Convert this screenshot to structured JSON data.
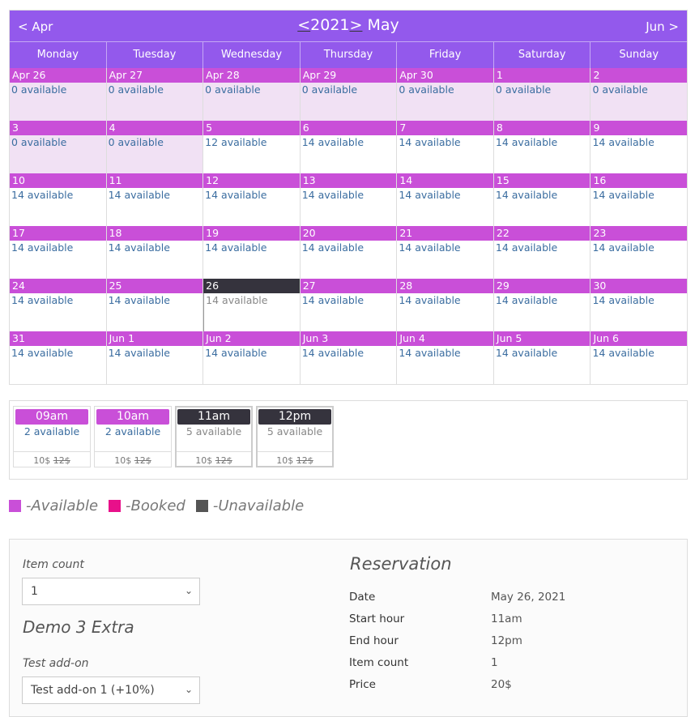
{
  "calendar": {
    "prev_month": "< Apr",
    "next_month": "Jun >",
    "year_prev": "<",
    "year": "2021",
    "year_next": ">",
    "month": "May",
    "weekdays": [
      "Monday",
      "Tuesday",
      "Wednesday",
      "Thursday",
      "Friday",
      "Saturday",
      "Sunday"
    ],
    "weeks": [
      [
        {
          "d": "Apr 26",
          "a": "0 available",
          "s": "past"
        },
        {
          "d": "Apr 27",
          "a": "0 available",
          "s": "past"
        },
        {
          "d": "Apr 28",
          "a": "0 available",
          "s": "past"
        },
        {
          "d": "Apr 29",
          "a": "0 available",
          "s": "past"
        },
        {
          "d": "Apr 30",
          "a": "0 available",
          "s": "past"
        },
        {
          "d": "1",
          "a": "0 available",
          "s": "past"
        },
        {
          "d": "2",
          "a": "0 available",
          "s": "past"
        }
      ],
      [
        {
          "d": "3",
          "a": "0 available",
          "s": "past"
        },
        {
          "d": "4",
          "a": "0 available",
          "s": "past"
        },
        {
          "d": "5",
          "a": "12 available",
          "s": ""
        },
        {
          "d": "6",
          "a": "14 available",
          "s": ""
        },
        {
          "d": "7",
          "a": "14 available",
          "s": ""
        },
        {
          "d": "8",
          "a": "14 available",
          "s": ""
        },
        {
          "d": "9",
          "a": "14 available",
          "s": ""
        }
      ],
      [
        {
          "d": "10",
          "a": "14 available",
          "s": ""
        },
        {
          "d": "11",
          "a": "14 available",
          "s": ""
        },
        {
          "d": "12",
          "a": "14 available",
          "s": ""
        },
        {
          "d": "13",
          "a": "14 available",
          "s": ""
        },
        {
          "d": "14",
          "a": "14 available",
          "s": ""
        },
        {
          "d": "15",
          "a": "14 available",
          "s": ""
        },
        {
          "d": "16",
          "a": "14 available",
          "s": ""
        }
      ],
      [
        {
          "d": "17",
          "a": "14 available",
          "s": ""
        },
        {
          "d": "18",
          "a": "14 available",
          "s": ""
        },
        {
          "d": "19",
          "a": "14 available",
          "s": ""
        },
        {
          "d": "20",
          "a": "14 available",
          "s": ""
        },
        {
          "d": "21",
          "a": "14 available",
          "s": ""
        },
        {
          "d": "22",
          "a": "14 available",
          "s": ""
        },
        {
          "d": "23",
          "a": "14 available",
          "s": ""
        }
      ],
      [
        {
          "d": "24",
          "a": "14 available",
          "s": ""
        },
        {
          "d": "25",
          "a": "14 available",
          "s": ""
        },
        {
          "d": "26",
          "a": "14 available",
          "s": "sel"
        },
        {
          "d": "27",
          "a": "14 available",
          "s": ""
        },
        {
          "d": "28",
          "a": "14 available",
          "s": ""
        },
        {
          "d": "29",
          "a": "14 available",
          "s": ""
        },
        {
          "d": "30",
          "a": "14 available",
          "s": ""
        }
      ],
      [
        {
          "d": "31",
          "a": "14 available",
          "s": ""
        },
        {
          "d": "Jun 1",
          "a": "14 available",
          "s": ""
        },
        {
          "d": "Jun 2",
          "a": "14 available",
          "s": ""
        },
        {
          "d": "Jun 3",
          "a": "14 available",
          "s": ""
        },
        {
          "d": "Jun 4",
          "a": "14 available",
          "s": ""
        },
        {
          "d": "Jun 5",
          "a": "14 available",
          "s": ""
        },
        {
          "d": "Jun 6",
          "a": "14 available",
          "s": ""
        }
      ]
    ]
  },
  "slots": [
    {
      "time": "09am",
      "avail": "2 available",
      "price": "10$",
      "old_price": "12$",
      "selected": false
    },
    {
      "time": "10am",
      "avail": "2 available",
      "price": "10$",
      "old_price": "12$",
      "selected": false
    },
    {
      "time": "11am",
      "avail": "5 available",
      "price": "10$",
      "old_price": "12$",
      "selected": true
    },
    {
      "time": "12pm",
      "avail": "5 available",
      "price": "10$",
      "old_price": "12$",
      "selected": true
    }
  ],
  "legend": [
    {
      "label": "-Available",
      "color": "#c94fd8"
    },
    {
      "label": "-Booked",
      "color": "#e8108a"
    },
    {
      "label": "-Unavailable",
      "color": "#555555"
    }
  ],
  "form": {
    "item_count_label": "Item count",
    "item_count_value": "1",
    "extra_title": "Demo 3 Extra",
    "addon_label": "Test add-on",
    "addon_value": "Test add-on 1 (+10%)"
  },
  "reservation": {
    "title": "Reservation",
    "rows": [
      {
        "k": "Date",
        "v": "May 26, 2021"
      },
      {
        "k": "Start hour",
        "v": "11am"
      },
      {
        "k": "End hour",
        "v": "12pm"
      },
      {
        "k": "Item count",
        "v": "1"
      },
      {
        "k": "Price",
        "v": "20$"
      }
    ]
  }
}
